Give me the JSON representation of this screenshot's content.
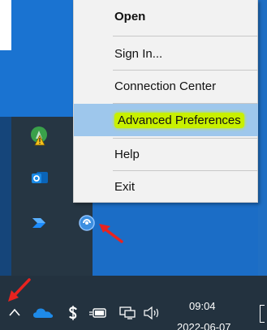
{
  "context_menu": {
    "items": [
      {
        "label": "Open",
        "bold": true
      },
      {
        "label": "Sign In..."
      },
      {
        "label": "Connection Center"
      },
      {
        "label": "Advanced Preferences",
        "highlighted": true
      },
      {
        "label": "Help"
      },
      {
        "label": "Exit"
      }
    ]
  },
  "tray_overflow": {
    "icons": [
      "warning-badge-icon",
      "outlook-icon",
      "power-automate-icon",
      "citrix-workspace-icon"
    ]
  },
  "taskbar": {
    "icons": [
      "chevron-up-icon",
      "onedrive-icon",
      "dollar-icon",
      "battery-icon",
      "network-icon",
      "volume-icon"
    ],
    "clock_time": "09:04",
    "clock_date": "2022-06-07"
  },
  "annotations": {
    "arrow_color": "#e8231f",
    "highlight_color": "#c8f000"
  }
}
